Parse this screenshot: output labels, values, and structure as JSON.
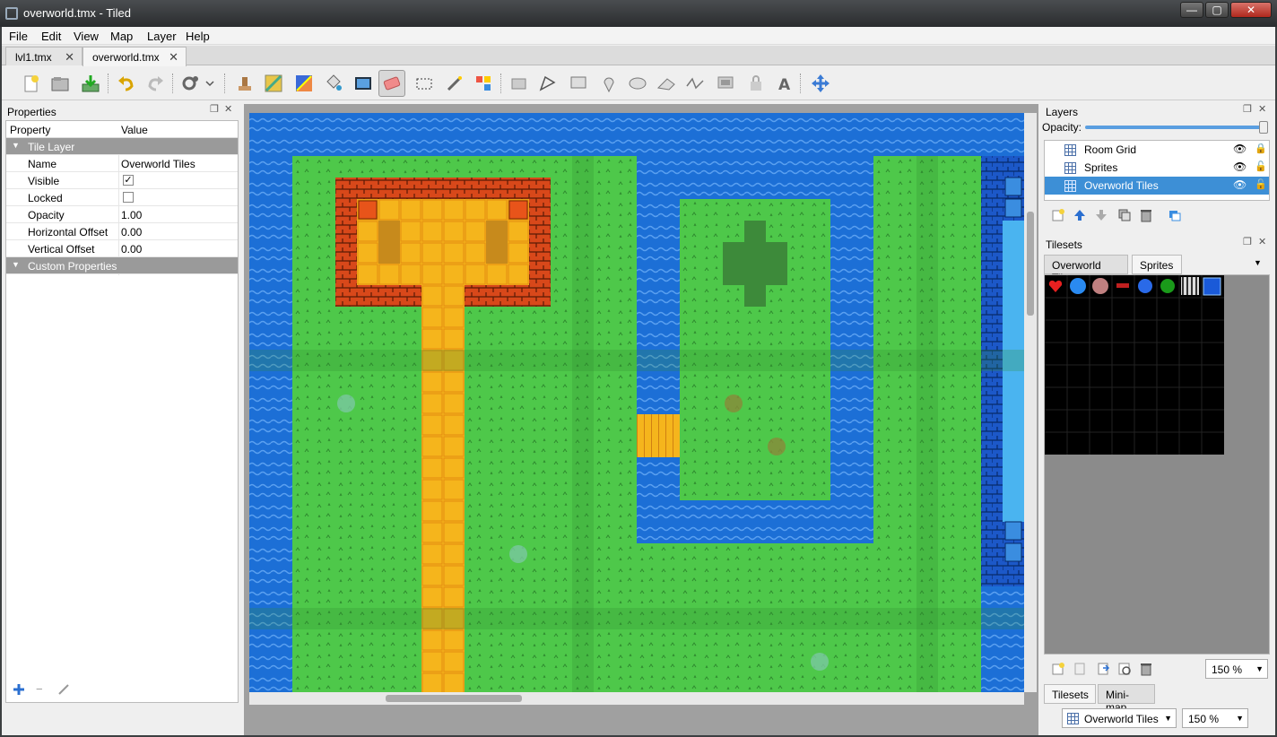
{
  "window": {
    "title": "overworld.tmx - Tiled",
    "min": "—",
    "max": "▢",
    "close": "✕"
  },
  "menu": [
    "File",
    "Edit",
    "View",
    "Map",
    "Layer",
    "Help"
  ],
  "tabs": [
    {
      "label": "lvl1.tmx",
      "close": "✕"
    },
    {
      "label": "overworld.tmx",
      "close": "✕"
    }
  ],
  "properties": {
    "title": "Properties",
    "col_property": "Property",
    "col_value": "Value",
    "group_tile_layer": "Tile Layer",
    "rows": [
      {
        "name": "Name",
        "value": "Overworld Tiles"
      },
      {
        "name": "Visible",
        "value": "✓"
      },
      {
        "name": "Locked",
        "value": ""
      },
      {
        "name": "Opacity",
        "value": "1.00"
      },
      {
        "name": "Horizontal Offset",
        "value": "0.00"
      },
      {
        "name": "Vertical Offset",
        "value": "0.00"
      }
    ],
    "group_custom": "Custom Properties",
    "add": "+",
    "remove": "−",
    "edit": "/"
  },
  "layers": {
    "title": "Layers",
    "opacity_label": "Opacity:",
    "opacity": 1.0,
    "items": [
      {
        "label": "Room Grid",
        "visible": "👁",
        "lock": "🔒"
      },
      {
        "label": "Sprites",
        "visible": "👁",
        "lock": "🔓"
      },
      {
        "label": "Overworld Tiles",
        "visible": "👁",
        "lock": "🔓"
      }
    ]
  },
  "tilesets": {
    "title": "Tilesets",
    "tabs": [
      "Overworld Tiles",
      "Sprites"
    ],
    "zoom": "150 %"
  },
  "bottom_tabs": [
    "Tilesets",
    "Mini-map"
  ],
  "status": {
    "layer": "Overworld Tiles",
    "zoom": "150 %"
  },
  "colors": {
    "water": "#1c6fd6",
    "grass": "#4ec84a",
    "path": "#f5b51c",
    "brick": "#d8481a",
    "selection": "#3d8fd6"
  }
}
